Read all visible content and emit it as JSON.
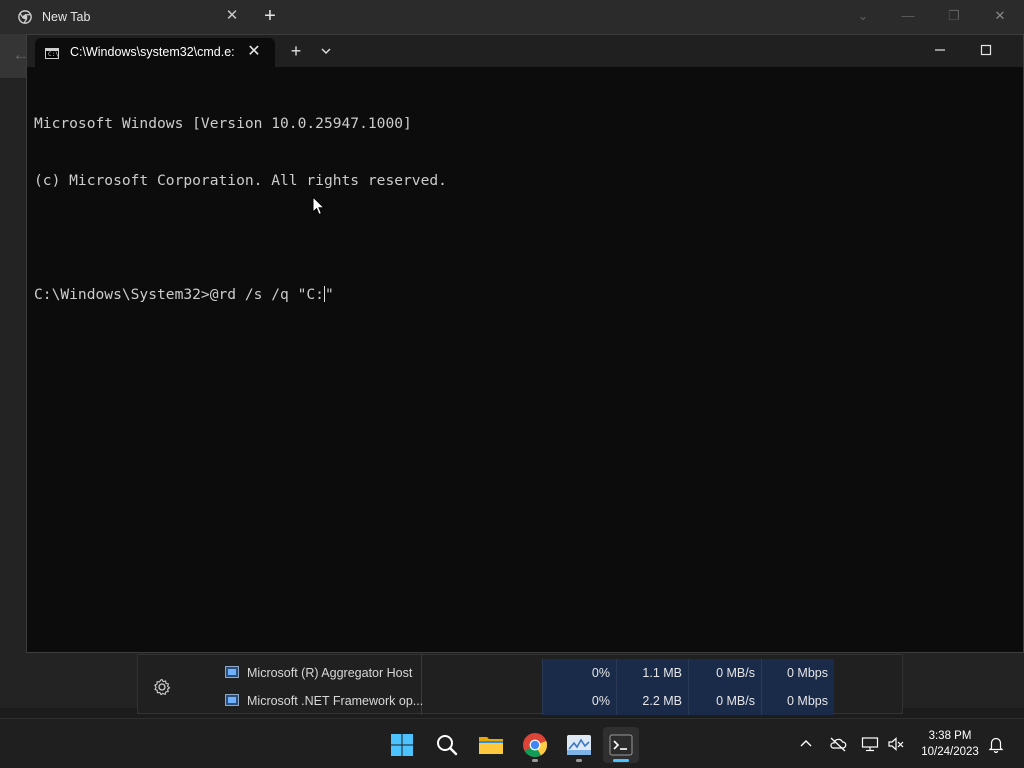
{
  "browser": {
    "tab_title": "New Tab",
    "tab_close_glyph": "✕",
    "new_tab_glyph": "+",
    "back_glyph": "←",
    "controls": {
      "dropdown": "⌄",
      "minimize": "—",
      "restore": "❐",
      "close": "✕"
    }
  },
  "terminal": {
    "tab_title": "C:\\Windows\\system32\\cmd.e:",
    "tab_close_glyph": "✕",
    "new_tab_glyph": "+",
    "lines": [
      "Microsoft Windows [Version 10.0.25947.1000]",
      "(c) Microsoft Corporation. All rights reserved.",
      ""
    ],
    "prompt": "C:\\Windows\\System32>",
    "command_typed": "@rd /s /q \"C:",
    "command_after_caret": "\""
  },
  "task_manager": {
    "rows": [
      {
        "name": "Microsoft (R) Aggregator Host",
        "cpu": "0%",
        "memory": "1.1 MB",
        "disk": "0 MB/s",
        "network": "0 Mbps"
      },
      {
        "name": "Microsoft .NET Framework op...",
        "cpu": "0%",
        "memory": "2.2 MB",
        "disk": "0 MB/s",
        "network": "0 Mbps"
      }
    ]
  },
  "taskbar": {
    "apps": [
      "start-icon",
      "search-icon",
      "file-explorer-icon",
      "chrome-icon",
      "task-manager-icon",
      "terminal-icon"
    ],
    "clock_time": "3:38 PM",
    "clock_date": "10/24/2023"
  },
  "colors": {
    "terminal_bg": "#0c0c0c",
    "terminal_text": "#cccccc",
    "taskbar_bg": "#1f1f1f",
    "accent": "#4cc2ff",
    "taskmgr_highlight": "#1a2b4a"
  }
}
